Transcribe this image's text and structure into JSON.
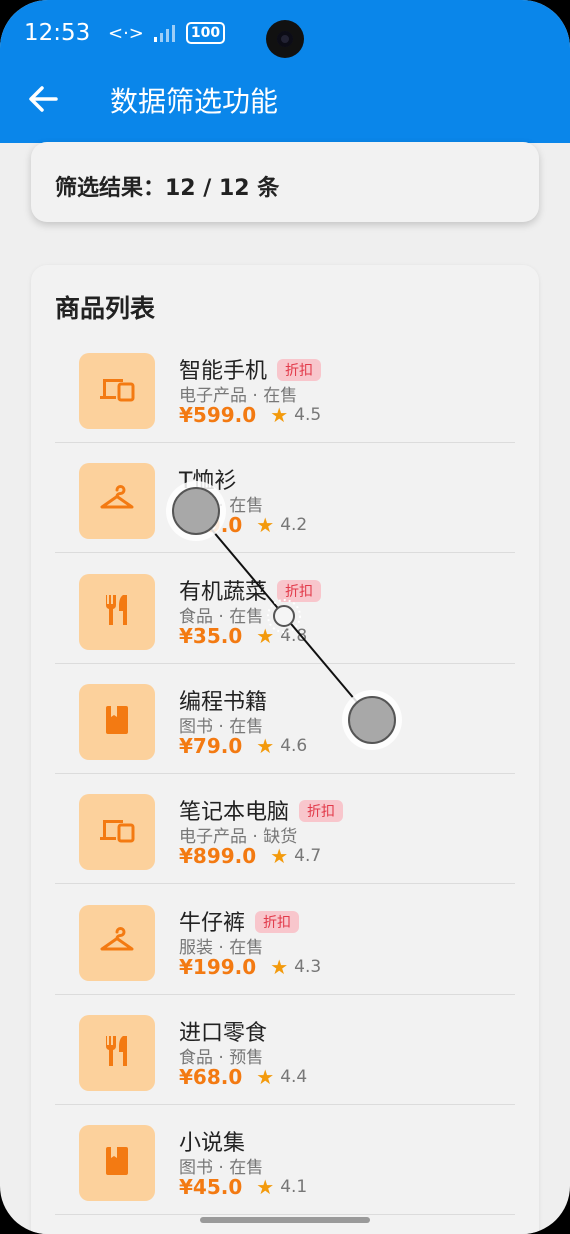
{
  "status": {
    "time": "12:53",
    "battery": "100"
  },
  "appbar": {
    "title": "数据筛选功能"
  },
  "result": {
    "text": "筛选结果：12 / 12 条"
  },
  "list": {
    "title": "商品列表",
    "items": [
      {
        "name": "智能手机",
        "badge": "折扣",
        "meta": "电子产品 · 在售",
        "price": "¥599.0",
        "rating": "4.5",
        "icon": "devices-icon"
      },
      {
        "name": "T恤衫",
        "badge": "",
        "meta": "服装 · 在售",
        "price": "¥89.0",
        "rating": "4.2",
        "icon": "hanger-icon"
      },
      {
        "name": "有机蔬菜",
        "badge": "折扣",
        "meta": "食品 · 在售",
        "price": "¥35.0",
        "rating": "4.8",
        "icon": "restaurant-icon"
      },
      {
        "name": "编程书籍",
        "badge": "",
        "meta": "图书 · 在售",
        "price": "¥79.0",
        "rating": "4.6",
        "icon": "book-icon"
      },
      {
        "name": "笔记本电脑",
        "badge": "折扣",
        "meta": "电子产品 · 缺货",
        "price": "¥899.0",
        "rating": "4.7",
        "icon": "devices-icon"
      },
      {
        "name": "牛仔裤",
        "badge": "折扣",
        "meta": "服装 · 在售",
        "price": "¥199.0",
        "rating": "4.3",
        "icon": "hanger-icon"
      },
      {
        "name": "进口零食",
        "badge": "",
        "meta": "食品 · 预售",
        "price": "¥68.0",
        "rating": "4.4",
        "icon": "restaurant-icon"
      },
      {
        "name": "小说集",
        "badge": "",
        "meta": "图书 · 在售",
        "price": "¥45.0",
        "rating": "4.1",
        "icon": "book-icon"
      }
    ]
  },
  "colors": {
    "appbar": "#0a86ea",
    "accent": "#f37a12",
    "thumb_bg": "#fcd19c",
    "badge_bg": "#f8c6cc",
    "badge_text": "#e23a4a"
  }
}
